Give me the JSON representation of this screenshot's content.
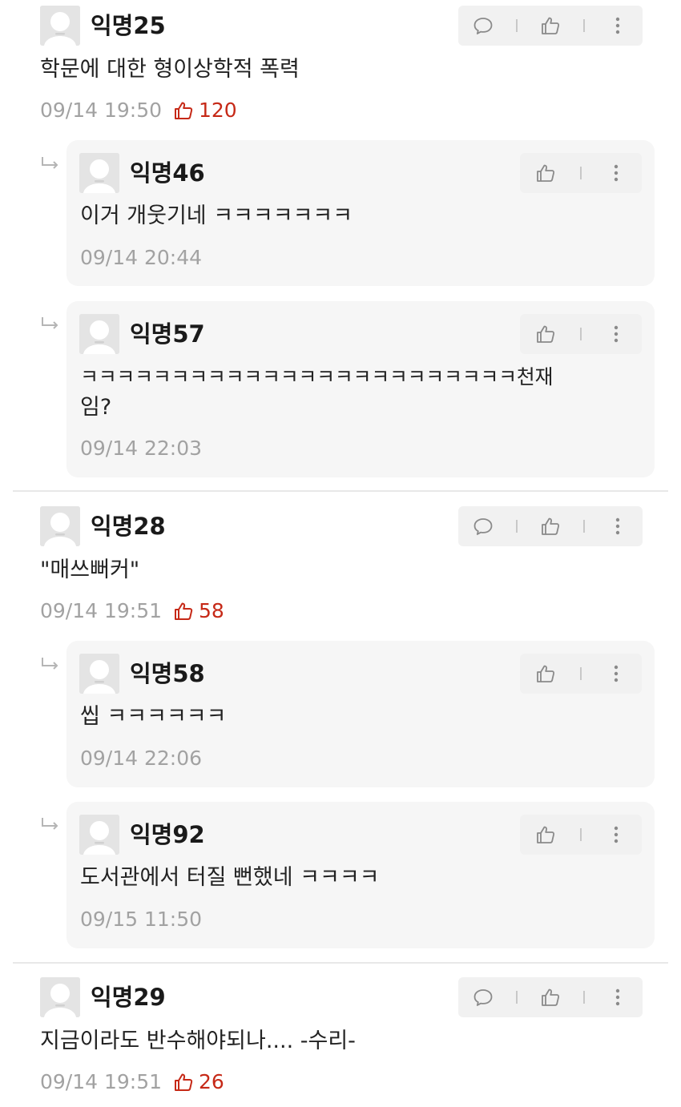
{
  "comments": [
    {
      "author": "익명25",
      "text": "학문에 대한 형이상학적 폭력",
      "time": "09/14 19:50",
      "likes": "120",
      "replies": [
        {
          "author": "익명46",
          "text": "이거 개웃기네 ㅋㅋㅋㅋㅋㅋㅋ",
          "time": "09/14 20:44"
        },
        {
          "author": "익명57",
          "text_line1": "ㅋㅋㅋㅋㅋㅋㅋㅋㅋㅋㅋㅋㅋㅋㅋㅋㅋㅋㅋㅋㅋㅋㅋㅋ천재",
          "text_line2": "임?",
          "time": "09/14 22:03"
        }
      ]
    },
    {
      "author": "익명28",
      "text": "\"매쓰뻐커\"",
      "time": "09/14 19:51",
      "likes": "58",
      "replies": [
        {
          "author": "익명58",
          "text": "씹 ㅋㅋㅋㅋㅋㅋ",
          "time": "09/14 22:06"
        },
        {
          "author": "익명92",
          "text": "도서관에서 터질 뻔했네 ㅋㅋㅋㅋ",
          "time": "09/15 11:50"
        }
      ]
    },
    {
      "author": "익명29",
      "text": "지금이라도 반수해야되나.... -수리-",
      "time": "09/14 19:51",
      "likes": "26",
      "replies": []
    }
  ],
  "icons": {
    "reply": "speech-bubble-icon",
    "like": "thumbs-up-icon",
    "more": "more-vertical-icon",
    "avatar": "default-avatar-icon",
    "reply_indicator": "reply-arrow-icon"
  },
  "colors": {
    "like_accent": "#c62917",
    "meta_gray": "#a2a2a2",
    "action_bg": "#f1f1f1",
    "reply_bg": "#f6f6f6"
  }
}
